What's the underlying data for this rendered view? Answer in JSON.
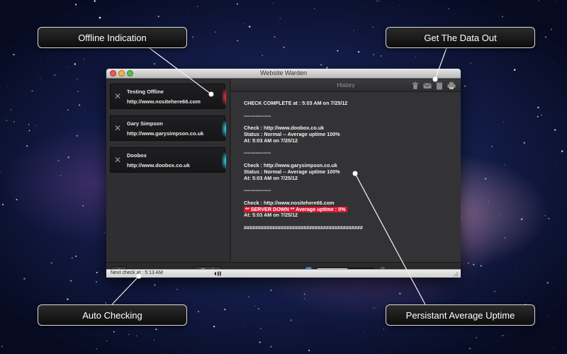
{
  "window": {
    "title": "Website Warden"
  },
  "callouts": {
    "offline": "Offline Indication",
    "data_out": "Get The Data Out",
    "auto_checking": "Auto Checking",
    "uptime": "Persistant Average Uptime"
  },
  "sites": [
    {
      "name": "Testing Offline",
      "url": "http://www.nositehere66.com",
      "status": "offline"
    },
    {
      "name": "Gary Simpson",
      "url": "http://www.garysimpson.co.uk",
      "status": "online"
    },
    {
      "name": "Doobox",
      "url": "http://www.doobox.co.uk",
      "status": "online"
    }
  ],
  "sidebar": {
    "add_label": "+",
    "check_label": "Check"
  },
  "main": {
    "history_label": "History"
  },
  "log": {
    "header": "CHECK COMPLETE at : 5:03 AM on 7/25/12",
    "separator": "----------------",
    "end_rule": "##########################################",
    "entries": [
      {
        "check": "Check :  http://www.doobox.co.uk",
        "status": "Status : Normal -- Average uptime 100%",
        "at": "At: 5:03 AM on 7/25/12"
      },
      {
        "check": "Check :  http://www.garysimpson.co.uk",
        "status": "Status : Normal -- Average uptime 100%",
        "at": "At: 5:03 AM on 7/25/12"
      },
      {
        "check": "Check :  http://www.nositehere66.com",
        "status": "** SERVER DOWN ** Average uptime : 0%",
        "at": "At: 5:03 AM on 7/25/12"
      }
    ]
  },
  "statusbar": {
    "next_check": "Next check at : 5:13 AM"
  },
  "colors": {
    "offline": "#ff3344",
    "online": "#33dfff",
    "server_down": "#e0162f"
  },
  "icons": [
    "trash-icon",
    "mail-icon",
    "clipboard-icon",
    "printer-icon",
    "document-icon",
    "bell-icon",
    "pause-icon",
    "resize-grip-icon",
    "close-x-icon"
  ]
}
